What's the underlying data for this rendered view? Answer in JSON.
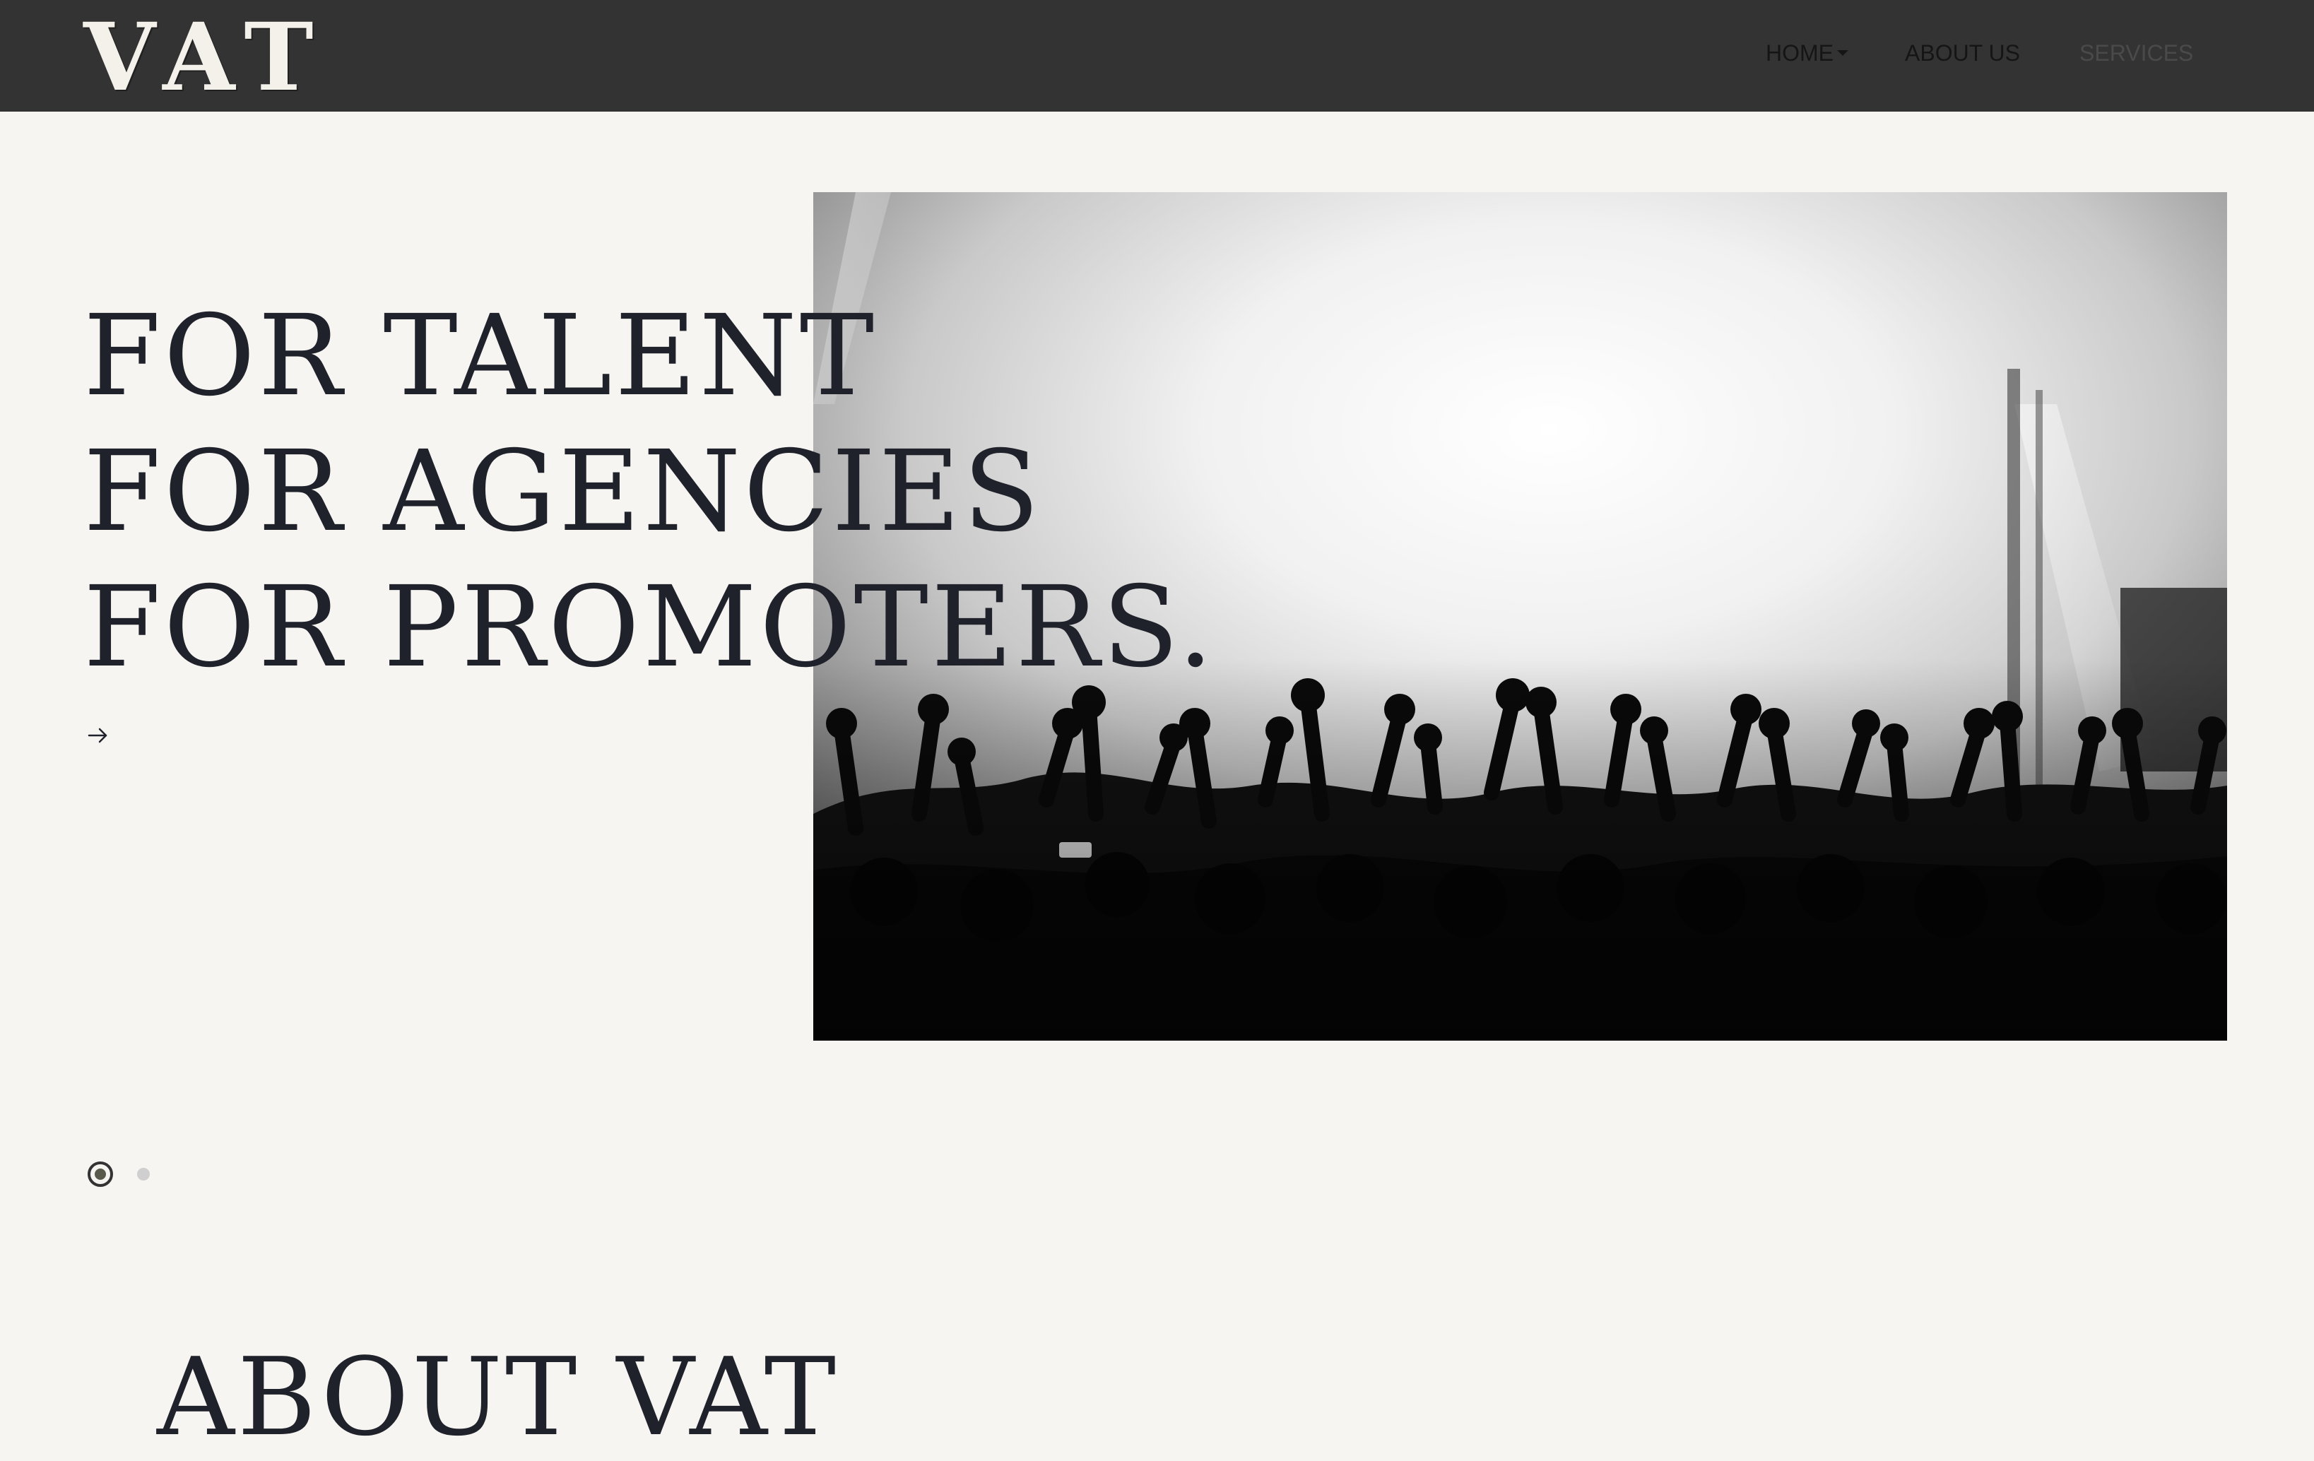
{
  "brand": {
    "logo_text": "VAT"
  },
  "nav": {
    "items": [
      {
        "label": "HOME"
      },
      {
        "label": "ABOUT US"
      },
      {
        "label": "SERVICES"
      }
    ]
  },
  "hero": {
    "lines": [
      "FOR TALENT",
      "FOR AGENCIES",
      "FOR PROMOTERS."
    ],
    "arrow_icon": "arrow-right-icon",
    "image_description_icon": "concert-crowd-photo"
  },
  "carousel": {
    "slide_count": 2,
    "active_index": 0
  },
  "about": {
    "heading": "ABOUT VAT"
  },
  "colors": {
    "navbar": "#333333",
    "page_background": "#f6f5f2",
    "heading_text": "#20222b",
    "logo": "#f4f1ea"
  }
}
